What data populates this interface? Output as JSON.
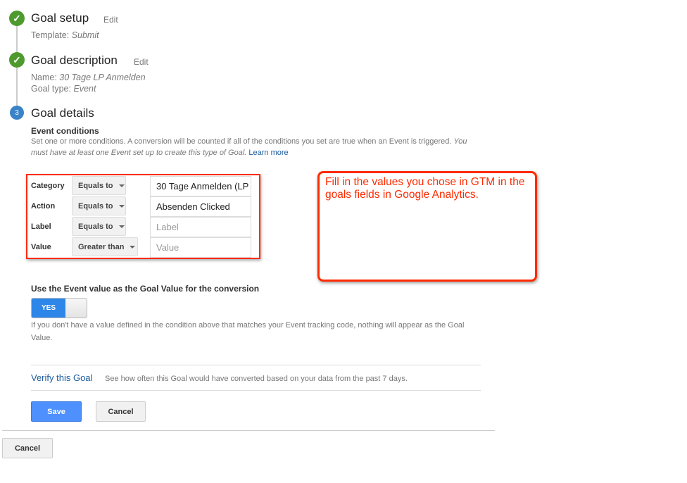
{
  "steps": [
    {
      "title": "Goal setup",
      "edit": "Edit",
      "lines": [
        {
          "label": "Template: ",
          "value": "Submit"
        }
      ],
      "status": "done"
    },
    {
      "title": "Goal description",
      "edit": "Edit",
      "lines": [
        {
          "label": "Name: ",
          "value": "30 Tage LP Anmelden"
        },
        {
          "label": "Goal type: ",
          "value": "Event"
        }
      ],
      "status": "done"
    },
    {
      "title": "Goal details",
      "number": "3",
      "status": "current"
    }
  ],
  "event_conditions": {
    "heading": "Event conditions",
    "desc": "Set one or more conditions. A conversion will be counted if all of the conditions you set are true when an Event is triggered.",
    "desc_italic": "You must have at least one Event set up to create this type of Goal.",
    "learn_more": "Learn more",
    "rows": [
      {
        "label": "Category",
        "operator": "Equals to",
        "value": "30 Tage Anmelden (LP",
        "placeholder": ""
      },
      {
        "label": "Action",
        "operator": "Equals to",
        "value": "Absenden Clicked",
        "placeholder": ""
      },
      {
        "label": "Label",
        "operator": "Equals to",
        "value": "",
        "placeholder": "Label"
      },
      {
        "label": "Value",
        "operator": "Greater than",
        "value": "",
        "placeholder": "Value"
      }
    ]
  },
  "callout": "Fill in the values you chose in GTM in the goals fields in Google Analytics.",
  "goal_value": {
    "heading": "Use the Event value as the Goal Value for the conversion",
    "toggle": "YES",
    "toggle_on": true,
    "help": "If you don't have a value defined in the condition above that matches your Event tracking code, nothing will appear as the Goal Value."
  },
  "verify": {
    "link": "Verify this Goal",
    "desc": "See how often this Goal would have converted based on your data from the past 7 days."
  },
  "buttons": {
    "save": "Save",
    "cancel": "Cancel",
    "outer_cancel": "Cancel"
  },
  "colors": {
    "done": "#4e9a2e",
    "current": "#3b83c8",
    "primary": "#4d90fe",
    "annotation": "#ff2a00",
    "link": "#1a5a9c"
  }
}
